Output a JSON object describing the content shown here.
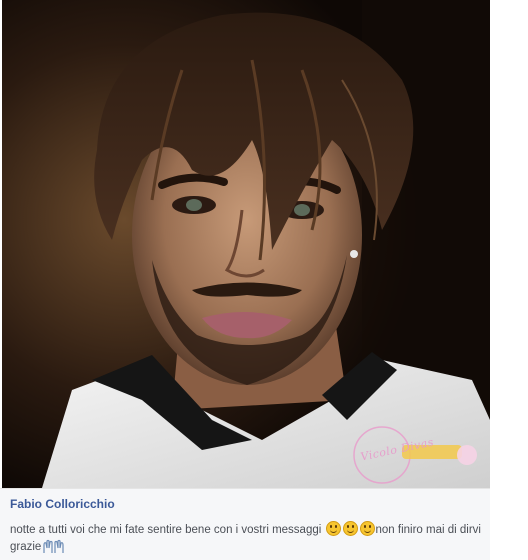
{
  "post": {
    "photo": {
      "watermark_text": "Vicolo Divas"
    },
    "caption": {
      "author": "Fabio Colloricchio",
      "message_part1": "notte a tutti voi che mi fate sentire bene con i vostri messaggi",
      "message_part2": "non finiro mai di dirvi grazie",
      "emojis": [
        "grinning-face-icon",
        "smiling-face-icon",
        "blushing-face-icon",
        "raised-hands-icon"
      ]
    }
  },
  "colors": {
    "author_link": "#3b5998",
    "caption_bg": "#f6f7f9",
    "text": "#4b4f56"
  }
}
